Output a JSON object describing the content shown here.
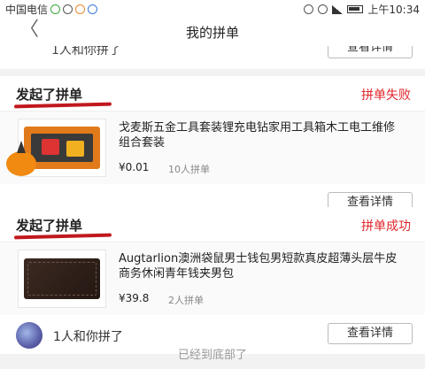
{
  "status_bar": {
    "carrier": "中国电信",
    "time": "上午10:34"
  },
  "nav": {
    "back_glyph": "〈",
    "title": "我的拼单"
  },
  "prev_item": {
    "joined_text": "1人和你拼了",
    "details_button": "查看详情"
  },
  "orders": [
    {
      "launch_label": "发起了拼单",
      "status": "拼单失败",
      "product_name": "戈麦斯五金工具套装锂充电钻家用工具箱木工电工维修组合套装",
      "price": "¥0.01",
      "people": "10人拼单",
      "details_button": "查看详情"
    },
    {
      "launch_label": "发起了拼单",
      "status": "拼单成功",
      "product_name": "Augtarlion澳洲袋鼠男士钱包男短款真皮超薄头层牛皮商务休闲青年钱夹男包",
      "price": "¥39.8",
      "people": "2人拼单",
      "joined_text": "1人和你拼了",
      "details_button": "查看详情"
    }
  ],
  "footer_text": "已经到底部了",
  "colors": {
    "status_red": "#e0262b",
    "underline_red": "#c0181e"
  }
}
